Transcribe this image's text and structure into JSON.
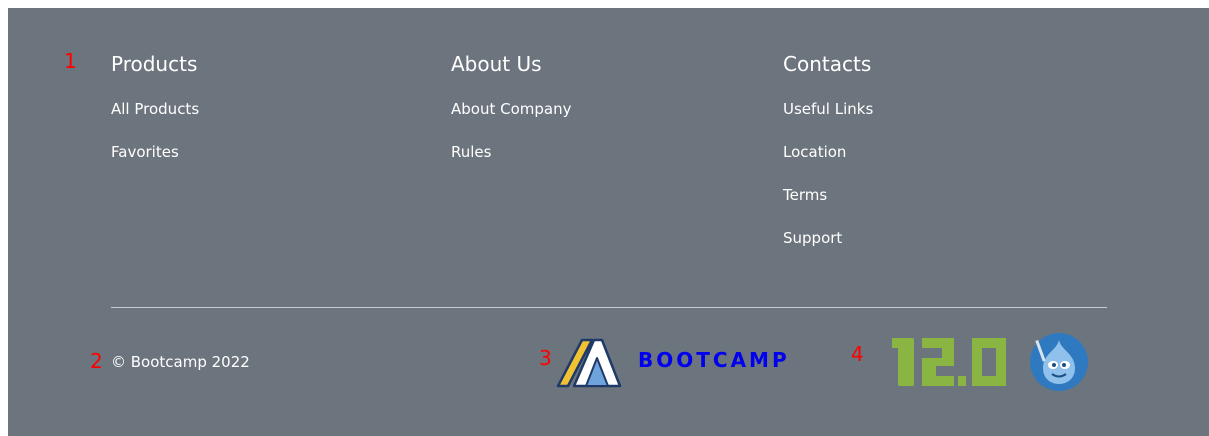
{
  "markers": [
    "1",
    "2",
    "3",
    "4"
  ],
  "columns": [
    {
      "title": "Products",
      "links": [
        "All Products",
        "Favorites"
      ]
    },
    {
      "title": "About Us",
      "links": [
        "About Company",
        "Rules"
      ]
    },
    {
      "title": "Contacts",
      "links": [
        "Useful Links",
        "Location",
        "Terms",
        "Support"
      ]
    }
  ],
  "bottom": {
    "copyright": "© Bootcamp 2022",
    "bootcamp_logo_text": "BOOTCAMP"
  },
  "colors": {
    "background": "#6c757d",
    "text": "#ffffff",
    "marker": "#ff0000",
    "i2_green": "#8ab543",
    "drupal_blue": "#2f79c0"
  },
  "icons": [
    "bootcamp-logo-icon",
    "i2-logo-icon",
    "drupal-logo-icon"
  ]
}
